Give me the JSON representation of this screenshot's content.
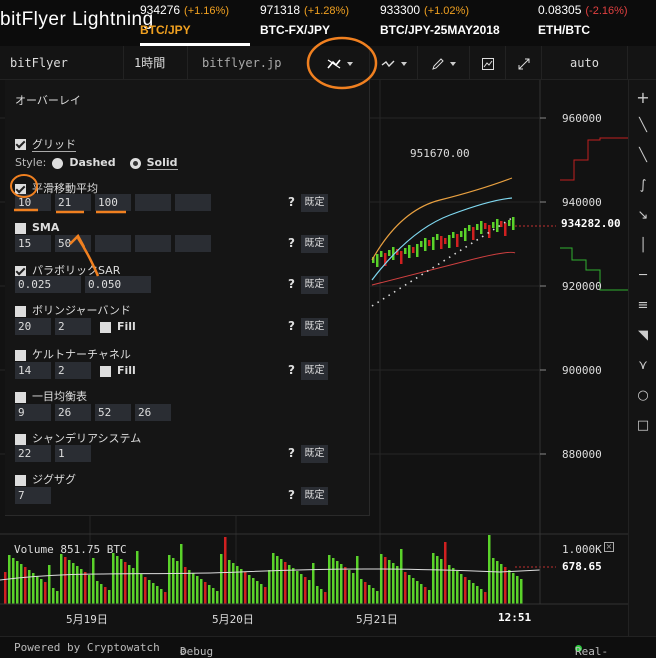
{
  "brand": {
    "logo": "bitFlyer Lightning"
  },
  "markets": [
    {
      "price": "934276",
      "change": "(+1.16%)",
      "pair": "BTC/JPY",
      "change_color": "#f0a020"
    },
    {
      "price": "971318",
      "change": "(+1.28%)",
      "pair": "BTC-FX/JPY",
      "change_color": "#f0a020"
    },
    {
      "price": "933300",
      "change": "(+1.02%)",
      "pair": "BTC/JPY-25MAY2018",
      "change_color": "#f0a020"
    },
    {
      "price": "0.08305",
      "change": "(-2.16%)",
      "pair": "ETH/BTC",
      "change_color": "#e04040"
    }
  ],
  "toolbar": {
    "symbol": "bitFlyer BTCJPY",
    "interval": "1時間",
    "source": "bitflyer.jp",
    "zoom": "auto"
  },
  "overlay": {
    "title": "オーバーレイ",
    "grid_label": "グリッド",
    "style_label": "Style:",
    "dashed_label": "Dashed",
    "solid_label": "Solid",
    "default_label": "既定",
    "help": "?",
    "fill_label": "Fill",
    "indicators": [
      {
        "name": "平滑移動平均",
        "checked": true,
        "values": [
          "10",
          "21",
          "100",
          "",
          ""
        ]
      },
      {
        "name": "SMA",
        "checked": false,
        "values": [
          "15",
          "50",
          "",
          "",
          ""
        ]
      },
      {
        "name": "パラボリックSAR",
        "checked": true,
        "values": [
          "0.025",
          "0.050"
        ]
      },
      {
        "name": "ボリンジャーバンド",
        "checked": false,
        "values": [
          "20",
          "2"
        ]
      },
      {
        "name": "ケルトナーチャネル",
        "checked": false,
        "values": [
          "14",
          "2"
        ]
      },
      {
        "name": "一目均衡表",
        "checked": false,
        "values": [
          "9",
          "26",
          "52",
          "26"
        ]
      },
      {
        "name": "シャンデリアシステム",
        "checked": false,
        "values": [
          "22",
          "1"
        ]
      },
      {
        "name": "ジグザグ",
        "checked": false,
        "values": [
          "7"
        ]
      }
    ]
  },
  "chart": {
    "price_axis": [
      "960000",
      "940000",
      "920000",
      "900000",
      "880000"
    ],
    "last_price": "934282.00",
    "high_label": "951670.00",
    "volume_label": "Volume  851.75 BTC",
    "volume_axis": "1.000K",
    "volume_last": "678.65",
    "dates": [
      "5月19日",
      "5月20日",
      "5月21日"
    ],
    "time_label": "12:51"
  },
  "footer": {
    "powered": "Powered by Cryptowatch",
    "debug": "Debug",
    "realtime": "Real-time"
  }
}
